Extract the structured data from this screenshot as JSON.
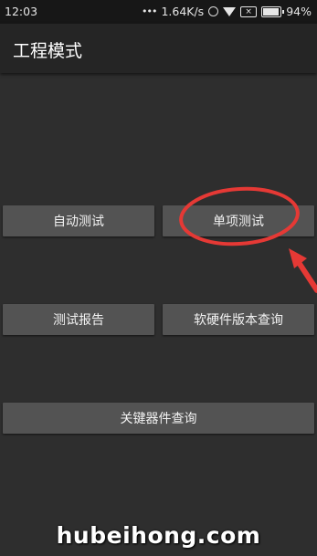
{
  "status_bar": {
    "time": "12:03",
    "network_speed": "1.64K/s",
    "battery_percent": "94%",
    "battery_level": 0.94,
    "icons": [
      "signal-dots-icon",
      "ring-icon",
      "wifi-icon",
      "sim-off-icon",
      "battery-icon"
    ]
  },
  "app_bar": {
    "title": "工程模式"
  },
  "buttons": {
    "auto_test": "自动测试",
    "single_test": "单项测试",
    "test_report": "测试报告",
    "hw_sw_version": "软硬件版本查询",
    "key_device_query": "关键器件查询"
  },
  "annotation": {
    "color": "#e53935"
  },
  "watermark": {
    "text": "hubeihong.com"
  }
}
